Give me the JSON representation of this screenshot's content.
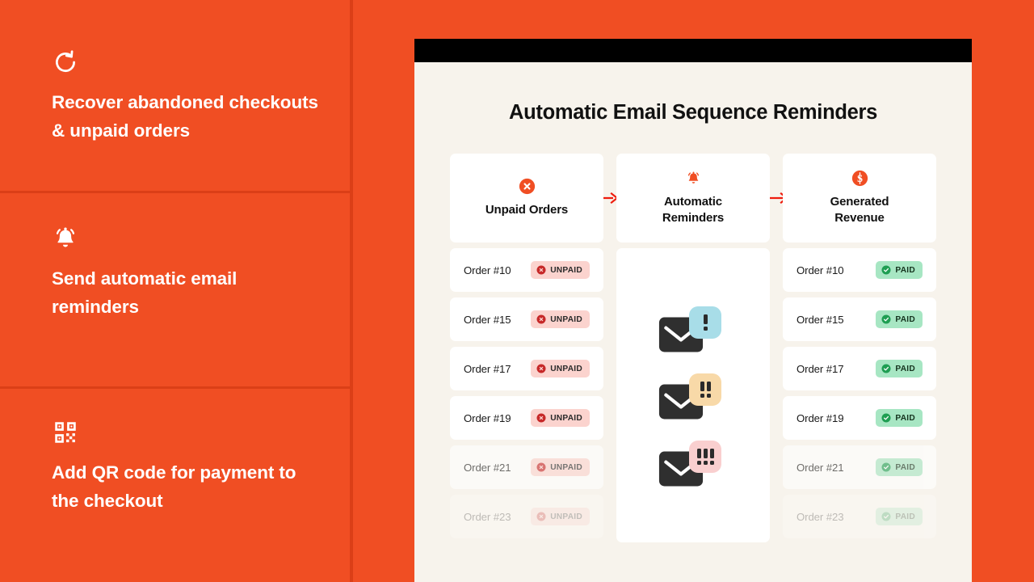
{
  "theme": {
    "brand_orange": "#F04E23",
    "divider_orange": "#DB3F17",
    "card_cream": "#F7F3EC",
    "white": "#FFFFFF",
    "black": "#000000",
    "badge_unpaid_bg": "#FBD3CE",
    "badge_paid_bg": "#A7E6C3",
    "unpaid_icon": "#C62828",
    "paid_icon": "#1E9E52",
    "arrow_red": "#EE1C0E"
  },
  "sidebar": {
    "features": [
      {
        "icon": "refresh-counterclockwise-icon",
        "text": "Recover abandoned checkouts & unpaid orders"
      },
      {
        "icon": "bell-ringing-icon",
        "text": "Send automatic email reminders"
      },
      {
        "icon": "qr-code-icon",
        "text": "Add QR code for payment to the checkout"
      }
    ]
  },
  "panel": {
    "browser_bar": "browser-chrome-bar",
    "title": "Automatic Email Sequence Reminders",
    "arrows": [
      "arrow-right-icon",
      "arrow-right-icon"
    ],
    "columns": [
      {
        "id": "unpaid-orders",
        "icon": "circle-x-icon",
        "heading": "Unpaid Orders",
        "rows": [
          {
            "label": "Order #10",
            "status": "UNPAID",
            "status_icon": "circle-x-icon",
            "fade": 0
          },
          {
            "label": "Order #15",
            "status": "UNPAID",
            "status_icon": "circle-x-icon",
            "fade": 0
          },
          {
            "label": "Order #17",
            "status": "UNPAID",
            "status_icon": "circle-x-icon",
            "fade": 0
          },
          {
            "label": "Order #19",
            "status": "UNPAID",
            "status_icon": "circle-x-icon",
            "fade": 0
          },
          {
            "label": "Order #21",
            "status": "UNPAID",
            "status_icon": "circle-x-icon",
            "fade": 1
          },
          {
            "label": "Order #23",
            "status": "UNPAID",
            "status_icon": "circle-x-icon",
            "fade": 2
          }
        ]
      },
      {
        "id": "automatic-reminders",
        "icon": "bell-ringing-icon",
        "heading": "Automatic Reminders",
        "mails": [
          {
            "badge_color": "#A8DDE8",
            "exclamations": 1,
            "label": "first-reminder"
          },
          {
            "badge_color": "#F8D9A8",
            "exclamations": 2,
            "label": "second-reminder"
          },
          {
            "badge_color": "#F9CFCF",
            "exclamations": 3,
            "label": "third-reminder"
          }
        ]
      },
      {
        "id": "generated-revenue",
        "icon": "circle-dollar-icon",
        "heading": "Generated Revenue",
        "rows": [
          {
            "label": "Order #10",
            "status": "PAID",
            "status_icon": "circle-check-icon",
            "fade": 0
          },
          {
            "label": "Order #15",
            "status": "PAID",
            "status_icon": "circle-check-icon",
            "fade": 0
          },
          {
            "label": "Order #17",
            "status": "PAID",
            "status_icon": "circle-check-icon",
            "fade": 0
          },
          {
            "label": "Order #19",
            "status": "PAID",
            "status_icon": "circle-check-icon",
            "fade": 0
          },
          {
            "label": "Order #21",
            "status": "PAID",
            "status_icon": "circle-check-icon",
            "fade": 1
          },
          {
            "label": "Order #23",
            "status": "PAID",
            "status_icon": "circle-check-icon",
            "fade": 2
          }
        ]
      }
    ]
  }
}
